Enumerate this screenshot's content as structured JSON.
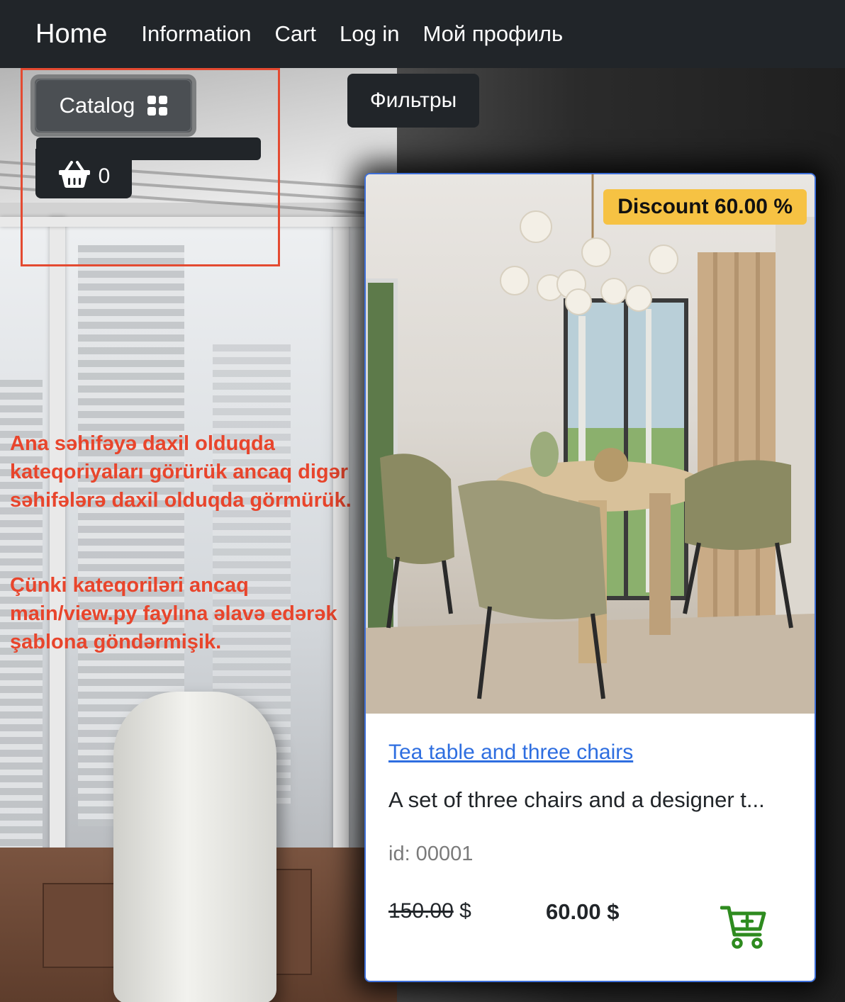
{
  "nav": {
    "brand": "Home",
    "links": [
      "Information",
      "Cart",
      "Log in",
      "Мой профиль"
    ]
  },
  "controls": {
    "catalog_label": "Catalog",
    "basket_count": "0",
    "filters_label": "Фильтры"
  },
  "annotation": {
    "paragraph1": "Ana səhifəyə daxil olduqda kateqoriyaları görürük ancaq digər səhifələrə daxil olduqda görmürük.",
    "paragraph2": "Çünki kateqoriləri ancaq main/view.py faylına əlavə edərək şablona göndərmişik.",
    "color": "#e8452c"
  },
  "product": {
    "discount": "Discount 60.00 %",
    "title": "Tea table and three chairs",
    "description": "A set of three chairs and a designer t...",
    "id_text": "id: 00001",
    "old_price": "150.00",
    "old_price_currency": " $",
    "price": "60.00 $"
  },
  "colors": {
    "navbar": "#212529",
    "link": "#2e6ee0",
    "discount_badge": "#f6c243",
    "cart_icon": "#2e8b1f"
  }
}
